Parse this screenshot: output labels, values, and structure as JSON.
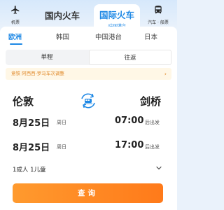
{
  "modes": {
    "flight": {
      "label": "机票",
      "icon": "airplane-icon"
    },
    "domestic": {
      "label": "国内火车"
    },
    "international": {
      "label": "国际火车",
      "sub": "/中国港台"
    },
    "bus": {
      "label": "汽车 · 船票",
      "icon": "bus-icon"
    }
  },
  "regions": [
    {
      "label": "欧洲",
      "active": true
    },
    {
      "label": "韩国",
      "active": false
    },
    {
      "label": "中国港台",
      "active": false
    },
    {
      "label": "日本",
      "active": false
    }
  ],
  "trip": {
    "one_way": "单程",
    "round_trip": "往返",
    "selected": "round_trip"
  },
  "notice": {
    "text": "意铁 阿西西-罗马车次调整",
    "icon": "chevron-right-icon"
  },
  "route": {
    "from": "伦敦",
    "to": "剑桥",
    "swap_icon": "train-swap-icon"
  },
  "outbound": {
    "date": "8月25日",
    "weekday": "周日",
    "time": "07:00",
    "suffix": "后出发"
  },
  "return": {
    "date": "8月25日",
    "weekday": "周日",
    "time": "17:00",
    "suffix": "后出发"
  },
  "passengers": {
    "label": "1成人 1儿童",
    "icon": "chevron-down-icon"
  },
  "search": {
    "label": "查询"
  },
  "colors": {
    "accent": "#1e88e5",
    "button": "#ff8a24",
    "notice_text": "#e08a2b"
  }
}
